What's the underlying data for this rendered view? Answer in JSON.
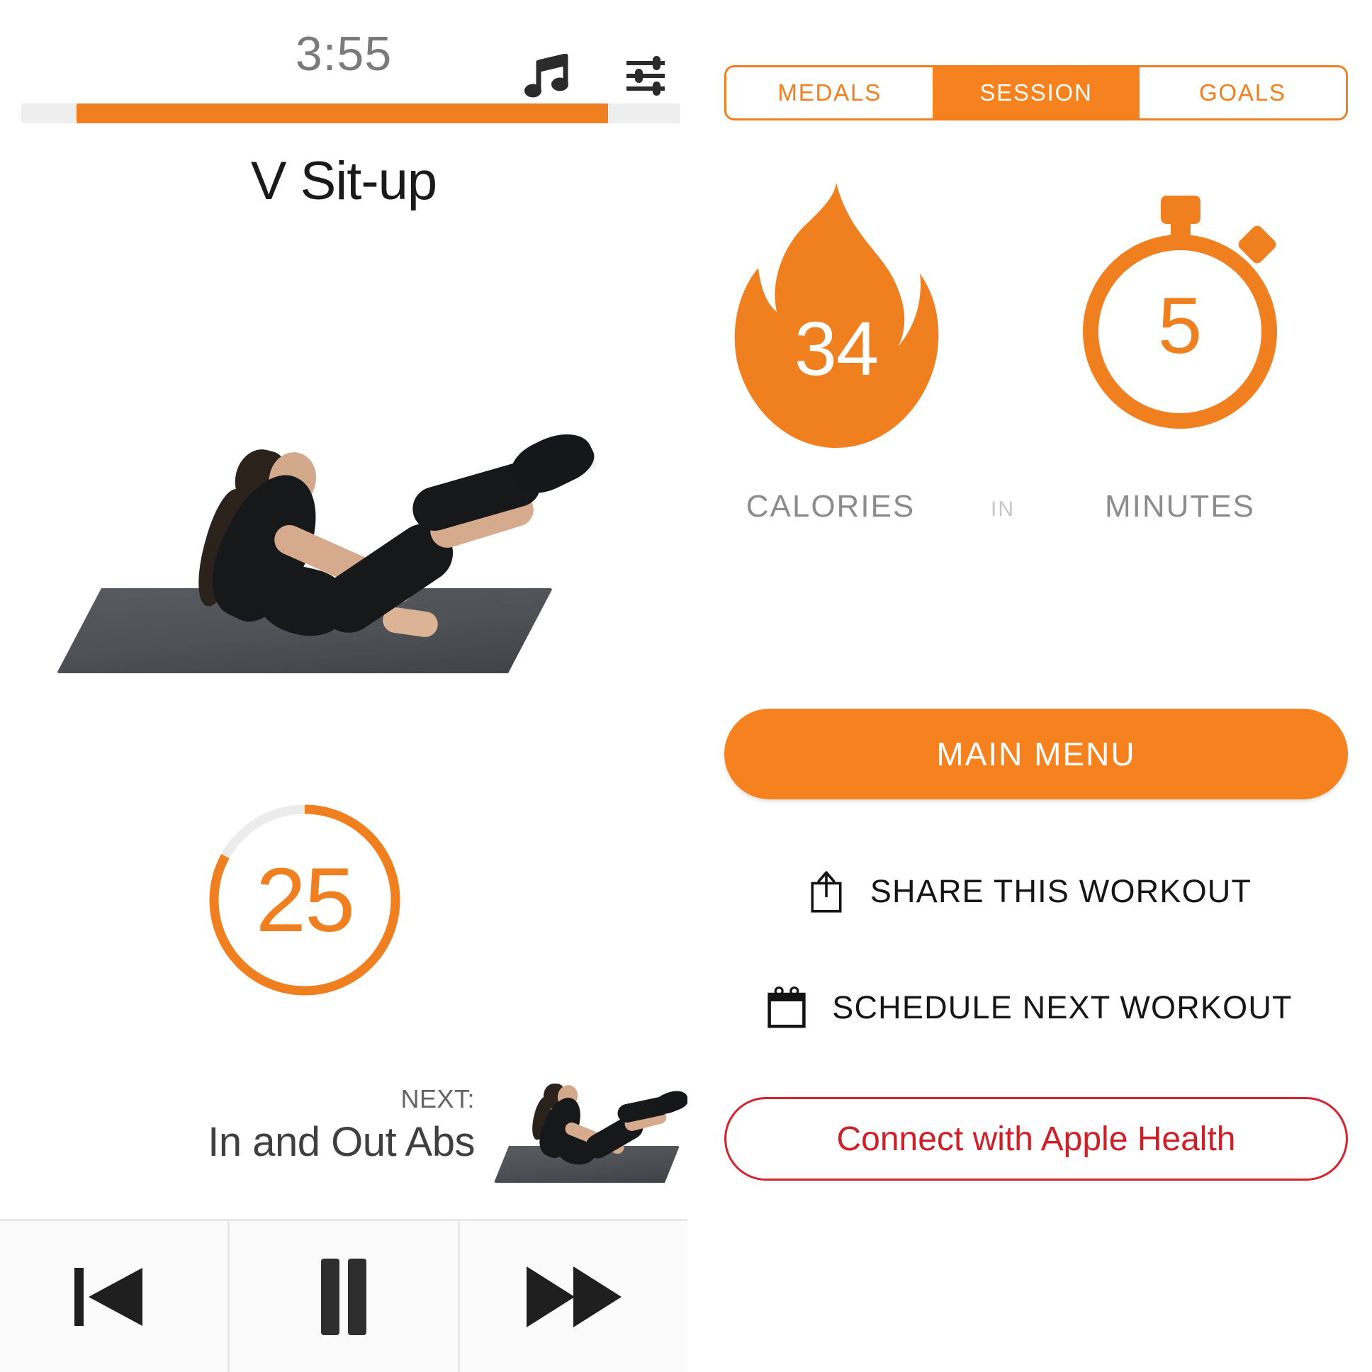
{
  "left": {
    "timer": "3:55",
    "icons": {
      "music": "music-note-icon",
      "settings": "sliders-icon"
    },
    "progress": {
      "percent": 88,
      "start_offset_percent": 8
    },
    "exercise_title": "V Sit-up",
    "exercise_image_alt": "Woman performing V Sit-up on a gray exercise mat",
    "countdown": {
      "value": "25",
      "remaining_percent": 83
    },
    "next": {
      "kicker": "NEXT:",
      "name": "In and Out Abs",
      "thumb_alt": "Woman performing In and Out Abs on a gray mat"
    },
    "controls": [
      {
        "name": "previous-button",
        "icon": "skip-previous-icon"
      },
      {
        "name": "pause-button",
        "icon": "pause-icon"
      },
      {
        "name": "next-button",
        "icon": "fast-forward-icon"
      }
    ]
  },
  "right": {
    "tabs": [
      {
        "label": "MEDALS",
        "active": false
      },
      {
        "label": "SESSION",
        "active": true
      },
      {
        "label": "GOALS",
        "active": false
      }
    ],
    "stats": {
      "calories_value": "34",
      "calories_label": "CALORIES",
      "connector_label": "IN",
      "minutes_value": "5",
      "minutes_label": "MINUTES"
    },
    "main_menu_label": "MAIN MENU",
    "share_label": "SHARE THIS WORKOUT",
    "schedule_label": "SCHEDULE NEXT WORKOUT",
    "health_label": "Connect with Apple Health"
  },
  "colors": {
    "orange": "#f5821f",
    "orange_dark": "#ef7f1f",
    "red": "#cf1f27",
    "gray_text": "#8c8c8c",
    "track_gray": "#eeeeee"
  }
}
